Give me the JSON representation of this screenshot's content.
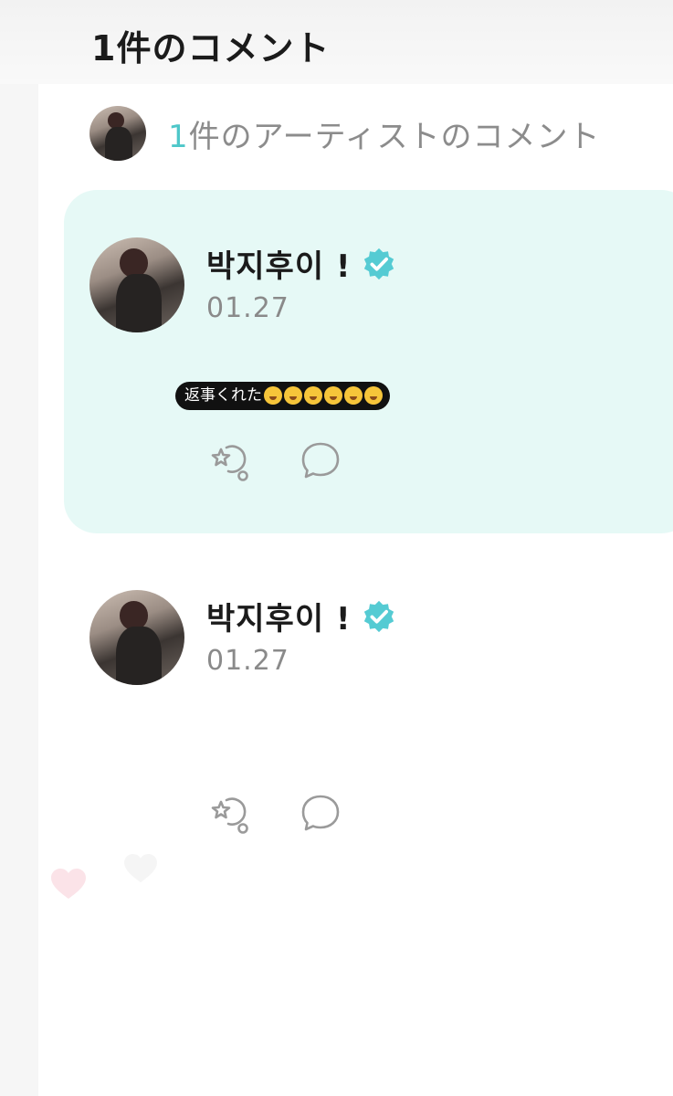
{
  "header": {
    "title": "1件のコメント"
  },
  "summary": {
    "count": "1",
    "label": "件のアーティストのコメント"
  },
  "comments": [
    {
      "name": "박지후이 !",
      "date": "01.27"
    },
    {
      "name": "박지후이 !",
      "date": "01.27"
    }
  ],
  "sticker": {
    "text": "返事くれた",
    "emoji_count": 6
  },
  "colors": {
    "accent": "#4ec7c9",
    "card_bg": "#e6f9f6",
    "verified": "#55cbd3",
    "muted": "#8a8a8a"
  },
  "icons": {
    "like": "cheer-star-icon",
    "reply": "speech-bubble-icon",
    "verified": "verified-badge-icon"
  }
}
